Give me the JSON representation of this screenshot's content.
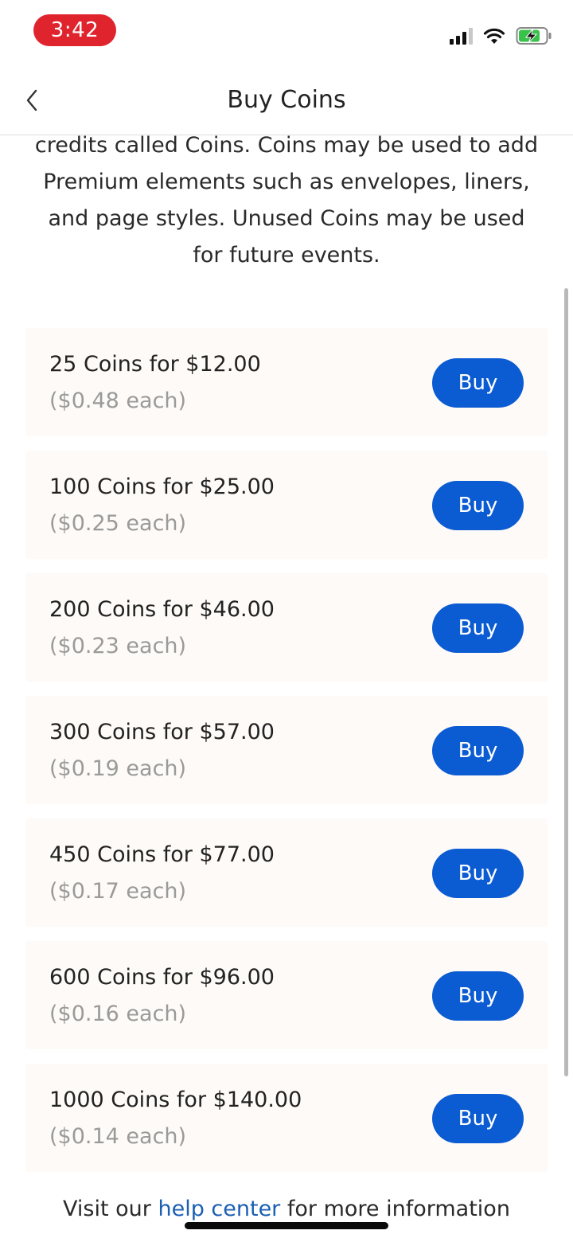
{
  "status_bar": {
    "time": "3:42",
    "icons": [
      "cellular-signal-icon",
      "wifi-icon",
      "battery-charging-icon"
    ]
  },
  "nav": {
    "title": "Buy Coins",
    "back_icon": "chevron-left-icon"
  },
  "intro": {
    "lines": [
      "credits called Coins. Coins may be used to add",
      "Premium elements such as envelopes, liners,",
      "and page styles. Unused Coins may be used",
      "for future events."
    ]
  },
  "packages": [
    {
      "title": "25 Coins for $12.00",
      "unit": "($0.48 each)",
      "button": "Buy"
    },
    {
      "title": "100 Coins for $25.00",
      "unit": "($0.25 each)",
      "button": "Buy"
    },
    {
      "title": "200 Coins for $46.00",
      "unit": "($0.23 each)",
      "button": "Buy"
    },
    {
      "title": "300 Coins for $57.00",
      "unit": "($0.19 each)",
      "button": "Buy"
    },
    {
      "title": "450 Coins for $77.00",
      "unit": "($0.17 each)",
      "button": "Buy"
    },
    {
      "title": "600 Coins for $96.00",
      "unit": "($0.16 each)",
      "button": "Buy"
    },
    {
      "title": "1000 Coins for $140.00",
      "unit": "($0.14 each)",
      "button": "Buy"
    }
  ],
  "footer": {
    "prefix": "Visit our ",
    "link": "help center",
    "suffix": " for more information"
  },
  "colors": {
    "accent": "#0b5bd3",
    "time_pill": "#e0242e",
    "card_bg": "#fdfaf7",
    "link": "#1a5fb4"
  }
}
